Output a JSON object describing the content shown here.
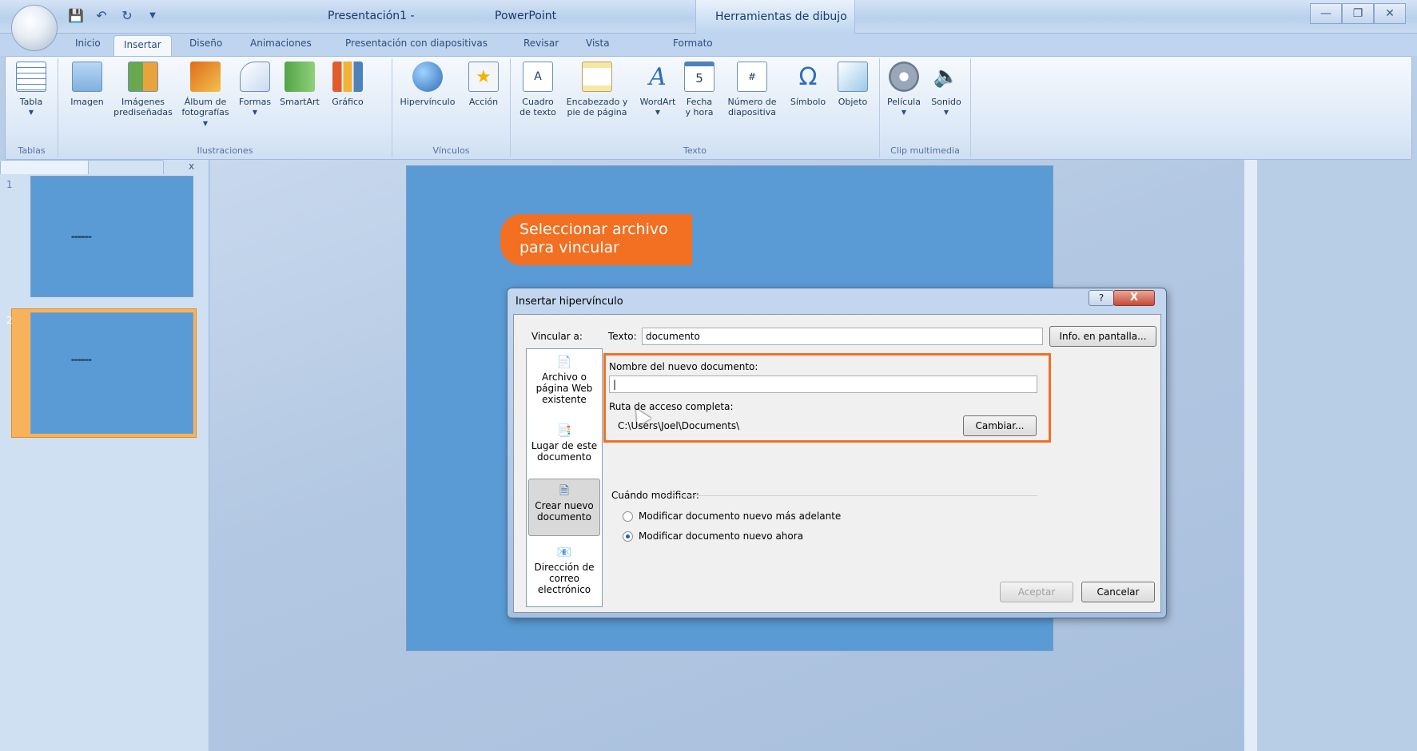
{
  "window": {
    "title_doc": "Presentación1 -",
    "title_app": "PowerPoint",
    "contextual_tab": "Herramientas de dibujo"
  },
  "tabs": [
    "Inicio",
    "Insertar",
    "Diseño",
    "Animaciones",
    "Presentación con diapositivas",
    "Revisar",
    "Vista",
    "Formato"
  ],
  "ribbon": {
    "groups": {
      "tablas": "Tablas",
      "ilustraciones": "Ilustraciones",
      "vinculos": "Vínculos",
      "texto": "Texto",
      "clip": "Clip multimedia"
    },
    "buttons": {
      "tabla": "Tabla",
      "imagen": "Imagen",
      "imagenes_l1": "Imágenes",
      "imagenes_l2": "prediseñadas",
      "album_l1": "Álbum de",
      "album_l2": "fotografías",
      "formas": "Formas",
      "smartart": "SmartArt",
      "grafico": "Gráfico",
      "hipervinculo": "Hipervínculo",
      "accion": "Acción",
      "cuadro_l1": "Cuadro",
      "cuadro_l2": "de texto",
      "encabezado_l1": "Encabezado y",
      "encabezado_l2": "pie de página",
      "wordart": "WordArt",
      "fecha_l1": "Fecha",
      "fecha_l2": "y hora",
      "numero_l1": "Número de",
      "numero_l2": "diapositiva",
      "simbolo": "Símbolo",
      "objeto": "Objeto",
      "pelicula": "Película",
      "sonido": "Sonido"
    }
  },
  "slides_panel": {
    "slide_numbers": [
      "1",
      "2"
    ],
    "close": "x"
  },
  "callout": {
    "line1": "Seleccionar archivo",
    "line2": "para vincular"
  },
  "dialog": {
    "title": "Insertar hipervínculo",
    "help": "?",
    "close": "X",
    "vincular_label": "Vincular a:",
    "texto_label": "Texto:",
    "texto_value": "documento",
    "info_button": "Info. en pantalla...",
    "link_options": {
      "archivo": [
        "Archivo o",
        "página Web",
        "existente"
      ],
      "lugar": [
        "Lugar de este",
        "documento"
      ],
      "crear": [
        "Crear nuevo",
        "documento"
      ],
      "correo": [
        "Dirección de",
        "correo",
        "electrónico"
      ]
    },
    "nombre_label": "Nombre del nuevo documento:",
    "nombre_value": "|",
    "ruta_label": "Ruta de acceso completa:",
    "ruta_value": "C:\\Users\\Joel\\Documents\\",
    "cambiar_button": "Cambiar...",
    "cuando_label": "Cuándo modificar:",
    "radio_later": "Modificar documento nuevo más adelante",
    "radio_now": "Modificar documento nuevo ahora",
    "aceptar_button": "Aceptar",
    "cancelar_button": "Cancelar"
  }
}
